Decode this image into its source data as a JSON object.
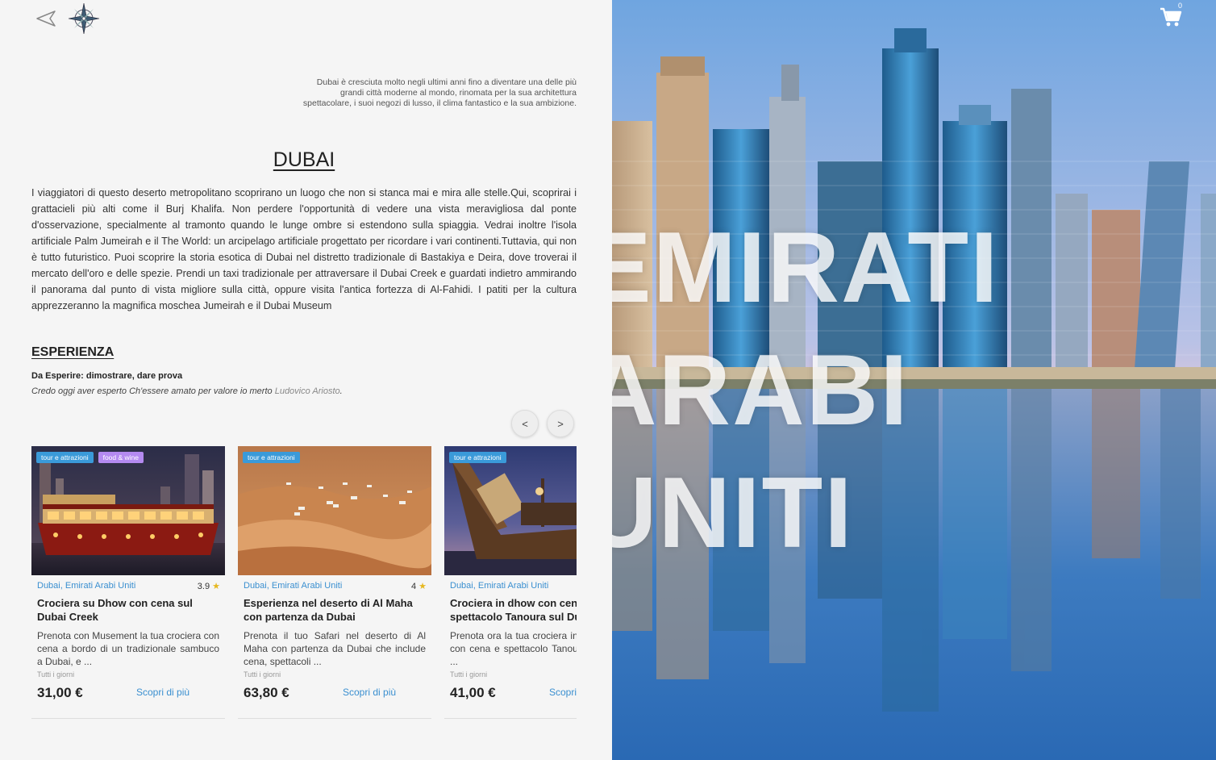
{
  "header": {
    "back_icon": "paper-plane-back-icon",
    "logo_icon": "compass-rose-icon"
  },
  "intro": "Dubai è cresciuta molto negli ultimi anni fino a diventare una delle più grandi città moderne al mondo, rinomata per la sua architettura spettacolare, i suoi negozi di lusso, il clima fantastico e la sua ambizione.",
  "title": "DUBAI",
  "description": "I viaggiatori di questo deserto metropolitano scoprirano un luogo che non si stanca mai e mira alle stelle.Qui, scoprirai i grattacieli più alti come il Burj Khalifa. Non perdere l'opportunità di vedere una vista meravigliosa dal ponte d'osservazione, specialmente al tramonto quando le lunge ombre si estendono sulla spiaggia. Vedrai inoltre l'isola artificiale Palm Jumeirah e il The World: un arcipelago artificiale progettato per ricordare i vari continenti.Tuttavia, qui non è tutto futuristico. Puoi scoprire la storia esotica di Dubai nel distretto tradizionale di Bastakiya e Deira, dove troverai il mercato dell'oro e delle spezie. Prendi un taxi tradizionale per attraversare il Dubai Creek e guardati indietro ammirando il panorama dal punto di vista migliore sulla città, oppure visita l'antica fortezza di Al-Fahidi. I patiti per la cultura apprezzeranno la magnifica moschea Jumeirah e il Dubai Museum",
  "experience": {
    "heading": "ESPERIENZA",
    "definition": "Da Esperire: dimostrare, dare prova",
    "quote": "Credo oggi aver esperto Ch'essere amato per valore io merto ",
    "author": "Ludovico Ariosto",
    "quote_end": "."
  },
  "carousel": {
    "prev_label": "<",
    "next_label": ">"
  },
  "cards": [
    {
      "tags": [
        {
          "label": "tour e attrazioni",
          "color": "#3a9ad9"
        },
        {
          "label": "food & wine",
          "color": "#b48af0"
        }
      ],
      "location": "Dubai, Emirati Arabi Uniti",
      "rating": "3.9",
      "title": "Crociera su Dhow con cena sul Dubai Creek",
      "text": "Prenota con Musement la tua crociera con cena a bordo di un tradizionale sambuco a Dubai, e ...",
      "days": "Tutti i giorni",
      "price": "31,00 €",
      "more": "Scopri di più"
    },
    {
      "tags": [
        {
          "label": "tour e attrazioni",
          "color": "#3a9ad9"
        }
      ],
      "location": "Dubai, Emirati Arabi Uniti",
      "rating": "4",
      "title": "Esperienza nel deserto di Al Maha con partenza da Dubai",
      "text": "Prenota il tuo Safari nel deserto di Al Maha con partenza da Dubai che include cena, spettacoli ...",
      "days": "Tutti i giorni",
      "price": "63,80 €",
      "more": "Scopri di più"
    },
    {
      "tags": [
        {
          "label": "tour e attrazioni",
          "color": "#3a9ad9"
        }
      ],
      "location": "Dubai, Emirati Arabi Uniti",
      "rating": "",
      "title": "Crociera in dhow con cena e spettacolo Tanoura sul Dubai",
      "text": "Prenota ora la tua crociera in barca dhow con cena e spettacolo Tanoura sul Dubai ...",
      "days": "Tutti i giorni",
      "price": "41,00 €",
      "more": "Scopri di più"
    }
  ],
  "hero": {
    "line1": "EMIRATI",
    "line2": "ARABI",
    "line3": "UNITI"
  },
  "cart": {
    "icon": "shopping-cart-icon",
    "count": "0"
  },
  "colors": {
    "accent_blue": "#3a8fd0",
    "tag_blue": "#3a9ad9",
    "tag_purple": "#b48af0",
    "star": "#e6b820"
  }
}
